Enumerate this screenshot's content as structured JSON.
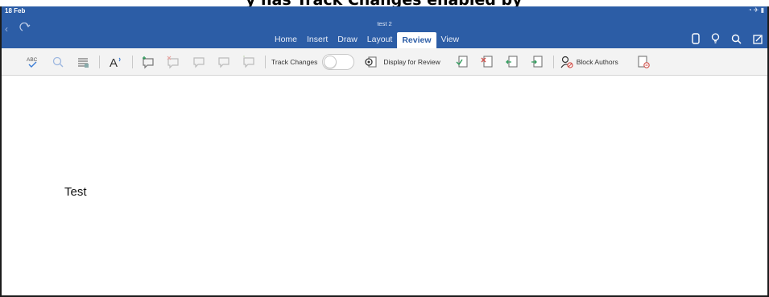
{
  "cropped_caption": "y has Track Changes enabled by",
  "status_bar": {
    "date": "18 Feb",
    "right_indicators": "◔ ✈ ▮"
  },
  "window": {
    "doc_title": "test 2"
  },
  "tabs": [
    {
      "label": "Home",
      "active": false
    },
    {
      "label": "Insert",
      "active": false
    },
    {
      "label": "Draw",
      "active": false
    },
    {
      "label": "Layout",
      "active": false
    },
    {
      "label": "Review",
      "active": true
    },
    {
      "label": "View",
      "active": false
    }
  ],
  "ribbon": {
    "spelling_icon_text": "ABC",
    "accessibility_glyph": "A",
    "track_changes_label": "Track Changes",
    "track_changes_on": false,
    "display_for_review_label": "Display for Review",
    "block_authors_label": "Block Authors"
  },
  "document": {
    "body_text": "Test"
  },
  "colors": {
    "title_bar": "#2c5da6",
    "ribbon_bg": "#f3f3f3",
    "accent_green": "#2e9a5a",
    "accent_red": "#d0504a"
  }
}
